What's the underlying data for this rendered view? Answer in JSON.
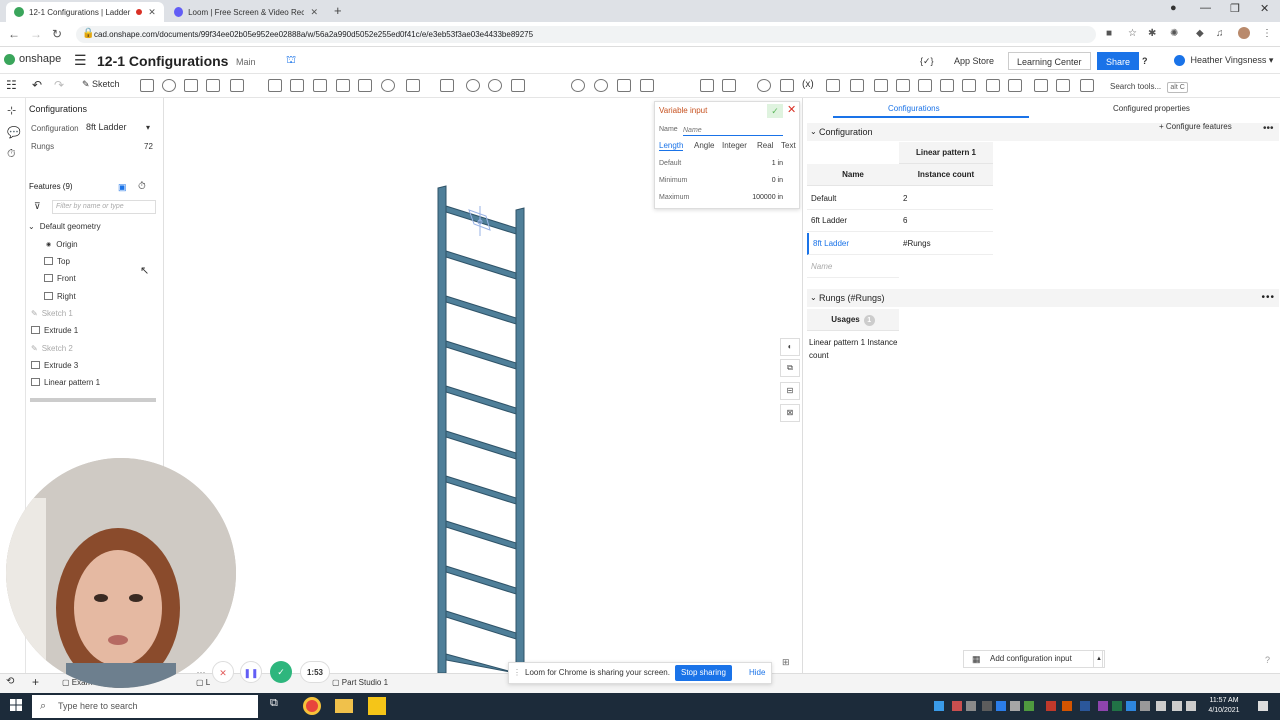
{
  "browser": {
    "tabs": [
      {
        "title": "12-1 Configurations | Ladder",
        "active": true
      },
      {
        "title": "Loom | Free Screen & Video Rec",
        "active": false
      }
    ],
    "url": "cad.onshape.com/documents/99f34ee02b05e952ee02888a/w/56a2a990d5052e255ed0f41c/e/e3eb53f3ae03e4433be89275"
  },
  "header": {
    "logo": "onshape",
    "doc_title": "12-1 Configurations",
    "branch": "Main",
    "code_label": "{✓}",
    "app_store": "App Store",
    "learning_center": "Learning Center",
    "share": "Share",
    "help": "?",
    "user_name": "Heather Vingsness"
  },
  "toolbar": {
    "sketch": "Sketch",
    "search_placeholder": "Search tools...",
    "search_shortcut": "alt C"
  },
  "config_panel_left": {
    "title": "Configurations",
    "configuration_label": "Configuration",
    "configuration_value": "8ft Ladder",
    "rungs_label": "Rungs",
    "rungs_value": "72"
  },
  "features": {
    "header": "Features (9)",
    "filter_placeholder": "Filter by name or type",
    "group": "Default geometry",
    "items": [
      {
        "label": "Origin",
        "dim": false
      },
      {
        "label": "Top",
        "dim": false
      },
      {
        "label": "Front",
        "dim": false
      },
      {
        "label": "Right",
        "dim": false
      },
      {
        "label": "Sketch 1",
        "dim": true
      },
      {
        "label": "Extrude 1",
        "dim": false
      },
      {
        "label": "Sketch 2",
        "dim": true
      },
      {
        "label": "Extrude 3",
        "dim": false
      },
      {
        "label": "Linear pattern 1",
        "dim": false
      }
    ]
  },
  "variable_input": {
    "title": "Variable input",
    "name_label": "Name",
    "name_placeholder": "Name",
    "tabs": [
      "Length",
      "Angle",
      "Integer",
      "Real",
      "Text"
    ],
    "active_tab": "Length",
    "rows": [
      {
        "label": "Default",
        "value": "1 in"
      },
      {
        "label": "Minimum",
        "value": "0 in"
      },
      {
        "label": "Maximum",
        "value": "100000 in"
      }
    ]
  },
  "right_panel": {
    "tabs": [
      "Configurations",
      "Configured properties"
    ],
    "configuration_section": "Configuration",
    "configure_features": "Configure features",
    "table": {
      "group_header": "Linear pattern 1",
      "name_header": "Name",
      "count_header": "Instance count",
      "rows": [
        {
          "name": "Default",
          "value": "2",
          "selected": false
        },
        {
          "name": "6ft Ladder",
          "value": "6",
          "selected": false
        },
        {
          "name": "8ft Ladder",
          "value": "#Rungs",
          "selected": true
        }
      ],
      "new_row_placeholder": "Name"
    },
    "rungs_section": "Rungs (#Rungs)",
    "usages_header": "Usages",
    "usages_count": "1",
    "usage_item": "Linear pattern 1 Instance count",
    "add_config_input": "Add configuration input"
  },
  "bottom_tabs": [
    "Exam",
    "L",
    "Part Studio 1"
  ],
  "loom": {
    "timer": "1:53",
    "message": "Loom for Chrome is sharing your screen.",
    "stop": "Stop sharing",
    "hide": "Hide"
  },
  "taskbar": {
    "search_placeholder": "Type here to search",
    "time": "11:57 AM",
    "date": "4/10/2021"
  },
  "colors": {
    "accent": "#1a73e8",
    "onshape_green": "#3aa55b",
    "variable_title": "#c7511f",
    "ladder": "#4f7f99"
  }
}
